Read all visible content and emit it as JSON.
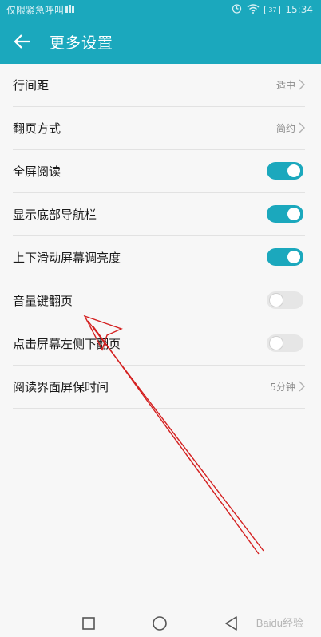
{
  "status_bar": {
    "carrier_text": "仅限紧急呼叫",
    "time": "15:34",
    "battery": "37",
    "icons": [
      "notification-icon",
      "alarm-icon",
      "wifi-icon",
      "battery-icon"
    ]
  },
  "toolbar": {
    "title": "更多设置",
    "back_icon": "arrow-left-icon"
  },
  "settings": {
    "items": [
      {
        "label": "行间距",
        "type": "select",
        "value": "适中"
      },
      {
        "label": "翻页方式",
        "type": "select",
        "value": "简约"
      },
      {
        "label": "全屏阅读",
        "type": "toggle",
        "on": true
      },
      {
        "label": "显示底部导航栏",
        "type": "toggle",
        "on": true
      },
      {
        "label": "上下滑动屏幕调亮度",
        "type": "toggle",
        "on": true
      },
      {
        "label": "音量键翻页",
        "type": "toggle",
        "on": false
      },
      {
        "label": "点击屏幕左侧下翻页",
        "type": "toggle",
        "on": false
      },
      {
        "label": "阅读界面屏保时间",
        "type": "select",
        "value": "5分钟"
      }
    ]
  },
  "nav_bar": {
    "icons": [
      "square-recents-icon",
      "circle-home-icon",
      "triangle-back-icon"
    ]
  },
  "watermark": "Baidu经验",
  "colors": {
    "accent": "#1ba8bd",
    "annotation_arrow": "#d42020",
    "background": "#f7f7f7",
    "divider": "#e2e2e2"
  }
}
